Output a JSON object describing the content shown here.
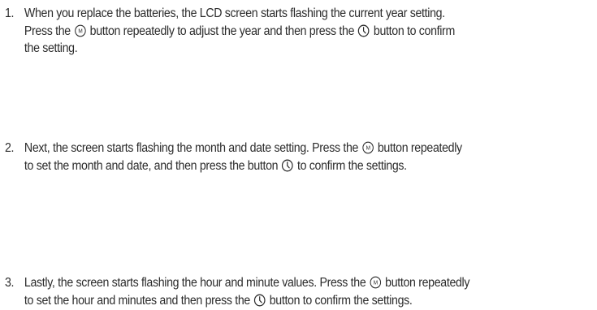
{
  "steps": [
    {
      "number": "1.",
      "lines": [
        [
          "When you replace the batteries, the LCD screen starts flashing the current year setting."
        ],
        [
          "Press the ",
          "button repeatedly to adjust the year and then press the ",
          "button to confirm"
        ],
        [
          "the setting."
        ]
      ]
    },
    {
      "number": "2.",
      "lines": [
        [
          "Next, the screen starts flashing the month and date setting. Press the ",
          "button repeatedly"
        ],
        [
          "to set the month and date, and then press the button ",
          "to confirm the settings."
        ]
      ]
    },
    {
      "number": "3.",
      "lines": [
        [
          "Lastly, the screen starts flashing the hour and minute values. Press the ",
          "button repeatedly"
        ],
        [
          "to set the hour and minutes and then press the ",
          "button to confirm the settings."
        ]
      ]
    }
  ],
  "icons": {
    "mode_button": "mode-button-icon",
    "clock_button": "clock-button-icon",
    "mode_button_glyph": "M"
  }
}
